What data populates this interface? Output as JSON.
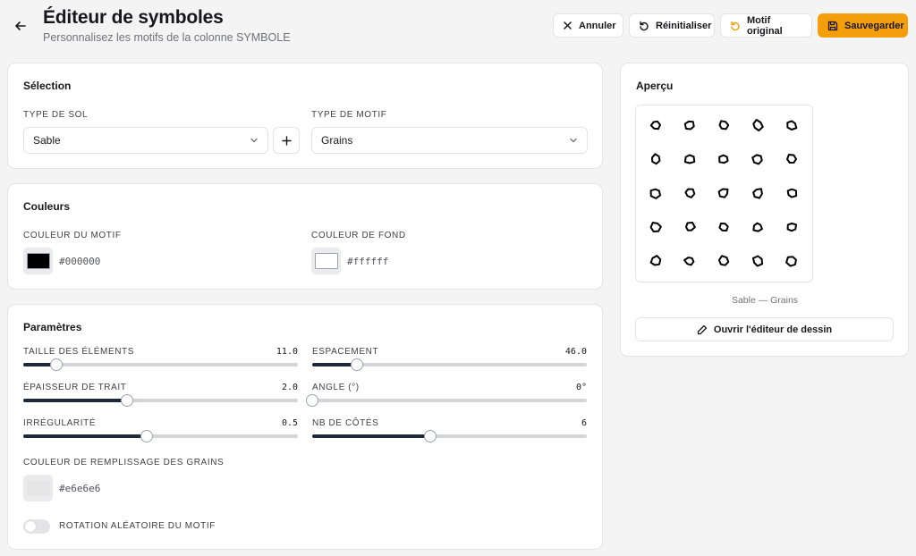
{
  "header": {
    "title": "Éditeur de symboles",
    "subtitle": "Personnalisez les motifs de la colonne SYMBOLE",
    "buttons": {
      "cancel": "Annuler",
      "reset": "Réinitialiser",
      "original": "Motif original",
      "save": "Sauvegarder"
    }
  },
  "selection": {
    "title": "Sélection",
    "soil_label": "TYPE DE SOL",
    "soil_value": "Sable",
    "motif_label": "TYPE DE MOTIF",
    "motif_value": "Grains"
  },
  "colors": {
    "title": "Couleurs",
    "motif_label": "COULEUR DU MOTIF",
    "motif_hex": "#000000",
    "bg_label": "COULEUR DE FOND",
    "bg_hex": "#ffffff"
  },
  "params": {
    "title": "Paramètres",
    "size": {
      "label": "TAILLE DES ÉLÉMENTS",
      "value": "11.0",
      "fraction": 0.12
    },
    "spacing": {
      "label": "ESPACEMENT",
      "value": "46.0",
      "fraction": 0.163
    },
    "stroke": {
      "label": "ÉPAISSEUR DE TRAIT",
      "value": "2.0",
      "fraction": 0.379
    },
    "angle": {
      "label": "ANGLE (°)",
      "value": "0°",
      "fraction": 0.0
    },
    "irregularity": {
      "label": "IRRÉGULARITÉ",
      "value": "0.5",
      "fraction": 0.45
    },
    "sides": {
      "label": "NB DE CÔTÉS",
      "value": "6",
      "fraction": 0.43
    },
    "fill_label": "COULEUR DE REMPLISSAGE DES GRAINS",
    "fill_hex": "#e6e6e6",
    "rotation_label": "ROTATION ALÉATOIRE DU MOTIF",
    "rotation_on": false
  },
  "preview": {
    "title": "Aperçu",
    "caption": "Sable — Grains",
    "draw_button": "Ouvrir l'éditeur de dessin"
  },
  "colors_theme": {
    "accent": "#f59e0b",
    "slider_fill": "#1e293b",
    "motif": "#000000",
    "background": "#ffffff",
    "grain_fill": "#e6e6e6"
  }
}
